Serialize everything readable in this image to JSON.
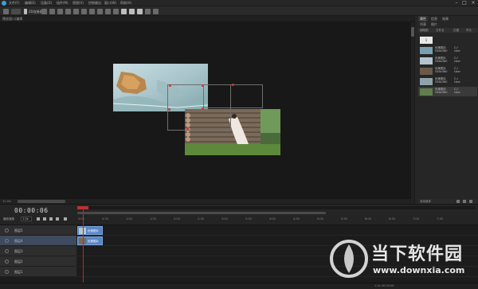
{
  "menubar": {
    "items": [
      "文件(F)",
      "编辑(E)",
      "设备(D)",
      "插件(M)",
      "视图(V)",
      "控制输出",
      "窗口(W)",
      "帮助(H)"
    ]
  },
  "toolbar": {
    "mode_label": "2D连接器"
  },
  "viewer": {
    "title": "播放窗口/编辑",
    "zoom": "12.5%"
  },
  "right_panel": {
    "tabs": [
      "属性",
      "信息",
      "效果"
    ],
    "subtabs": [
      "列表",
      "图片"
    ],
    "columns": [
      "缩略图",
      "文件名",
      "位置",
      "时长"
    ],
    "items": [
      {
        "name": "1",
        "label1": "",
        "label2": "",
        "path": ""
      },
      {
        "name": "优美图片",
        "label1": "546x360",
        "label2": "C:/",
        "path": "User"
      },
      {
        "name": "优美图片",
        "label1": "546x360",
        "label2": "C:/",
        "path": "User"
      },
      {
        "name": "优美图片",
        "label1": "546x360",
        "label2": "C:/",
        "path": "User"
      },
      {
        "name": "优美图片",
        "label1": "546x360",
        "label2": "C:/",
        "path": "User"
      },
      {
        "name": "优美图片",
        "label1": "546x360",
        "label2": "C:/",
        "path": "User"
      }
    ],
    "footer": "添加媒体"
  },
  "transport": {
    "timecode": "00:00:06"
  },
  "timeline": {
    "label": "播放速度",
    "speed": "1.0x",
    "ticks": [
      "0:00",
      "0:30",
      "1:00",
      "1:30",
      "2:00",
      "2:30",
      "3:00",
      "3:30",
      "4:00",
      "4:30",
      "5:00",
      "5:30",
      "6:00",
      "6:30",
      "7:00",
      "7:30"
    ],
    "tracks": [
      {
        "label": "图层5"
      },
      {
        "label": "图层4"
      },
      {
        "label": "图层3"
      },
      {
        "label": "图层2"
      },
      {
        "label": "图层1"
      }
    ],
    "clips": [
      {
        "label": "优美图片"
      },
      {
        "label": "优美图片"
      }
    ]
  },
  "status": {
    "text": "1.0x 00:00:06"
  },
  "watermark": {
    "title": "当下软件园",
    "url": "www.downxia.com"
  },
  "colors": {
    "accent": "#5a86c6",
    "playhead": "#d02020",
    "handle": "#e03030"
  }
}
